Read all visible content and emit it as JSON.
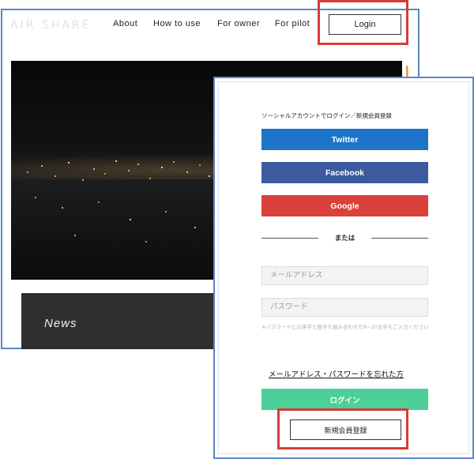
{
  "site": {
    "logo": "AIR SHARE",
    "nav": [
      "About",
      "How to use",
      "For owner",
      "For pilot"
    ],
    "login_label": "Login",
    "news_label": "News"
  },
  "login_panel": {
    "social_heading": "ソーシャルアカウントでログイン／新規会員登録",
    "twitter_label": "Twitter",
    "facebook_label": "Facebook",
    "google_label": "Google",
    "or_label": "または",
    "email_placeholder": "メールアドレス",
    "password_placeholder": "パスワード",
    "password_hint": "※パスワードには英字と数字を組み合わせた8~20文字をご入力ください",
    "forgot_link": "メールアドレス・パスワードを忘れた方",
    "login_button": "ログイン",
    "register_button": "新規会員登録"
  },
  "colors": {
    "highlight_red": "#d93a3a",
    "frame_blue": "#5b86c9",
    "arrow_orange": "#f0922b",
    "twitter": "#1d74c9",
    "facebook": "#3b5b9e",
    "google": "#d9413a",
    "login_green": "#4ccf98"
  }
}
